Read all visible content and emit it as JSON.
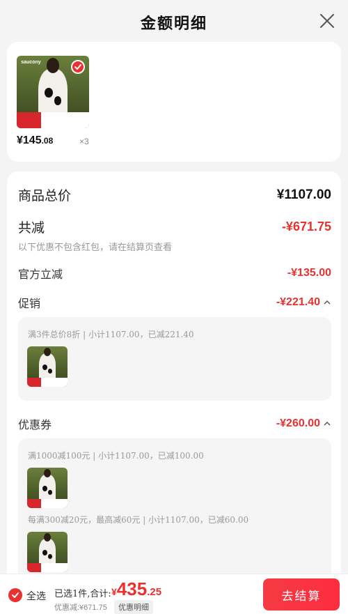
{
  "header": {
    "title": "金额明细"
  },
  "product": {
    "price_main": "¥145",
    "price_cents": ".08",
    "quantity": "×3",
    "brand_logo": "saucony"
  },
  "summary": {
    "total_label": "商品总价",
    "total_value": "¥1107.00",
    "reduce_label": "共减",
    "reduce_value": "-¥671.75",
    "reduce_note": "以下优惠不包含红包，请在结算页查看",
    "official_label": "官方立减",
    "official_value": "-¥135.00",
    "promo_label": "促销",
    "promo_value": "-¥221.40",
    "promo_desc": "满3件总价8折 | 小计1107.00，已减221.40",
    "coupon_label": "优惠券",
    "coupon_value": "-¥260.00",
    "coupon_desc_1": "满1000减100元 | 小计1107.00，已减100.00",
    "coupon_desc_2": "每满300减20元，最高减60元 | 小计1107.00，已减60.00"
  },
  "bottom_bar": {
    "select_all_label": "全选",
    "selected_text": "已选1件,合计:",
    "total_yen": "¥",
    "total_main": "435",
    "total_cents": ".25",
    "discount_text": "优惠减:¥671.75",
    "detail_label": "优惠明细",
    "checkout_label": "去结算"
  },
  "colors": {
    "accent": "#e8322f",
    "checkout_button": "#f53b44"
  }
}
